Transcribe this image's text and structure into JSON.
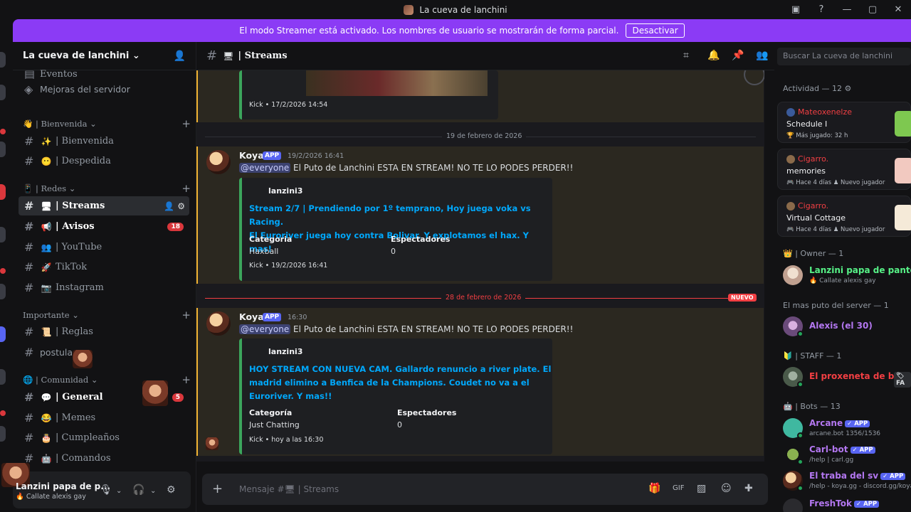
{
  "window": {
    "title": "La cueva de lanchini"
  },
  "banner": {
    "text": "El modo Streamer está activado. Los nombres de usuario se mostrarán de forma parcial.",
    "button": "Desactivar"
  },
  "server": {
    "name": "La cueva de lanchini ⌄"
  },
  "sidebar": {
    "top_items": [
      {
        "label": "Eventos"
      },
      {
        "label": "Mejoras del servidor"
      }
    ],
    "categories": {
      "bienvenida": "| Bienvenida ⌄",
      "redes": "| Redes ⌄",
      "importante": "Importante ⌄",
      "comunidad": "| Comunidad ⌄"
    },
    "channels": [
      {
        "emoji": "✨",
        "label": "| Bienvenida"
      },
      {
        "emoji": "😶",
        "label": "| Despedida"
      },
      {
        "emoji": "🖥",
        "label": "| Streams"
      },
      {
        "emoji": "📢",
        "label": "| Avisos",
        "badge": "18"
      },
      {
        "emoji": "👥",
        "label": "| YouTube"
      },
      {
        "emoji": "🚀",
        "label": "TikTok"
      },
      {
        "emoji": "📷",
        "label": "Instagram"
      },
      {
        "emoji": "📜",
        "label": "| Reglas"
      },
      {
        "emoji": "",
        "label": "postula"
      },
      {
        "emoji": "💬",
        "label": "| General",
        "badge": "5"
      },
      {
        "emoji": "😂",
        "label": "| Memes"
      },
      {
        "emoji": "🎂",
        "label": "| Cumpleaños"
      },
      {
        "emoji": "🤖",
        "label": "| Comandos"
      }
    ]
  },
  "user_panel": {
    "name": "Lanzini papa de p...",
    "status": "🔥 Callate alexis gay"
  },
  "channel_header": {
    "name": "| Streams",
    "search_placeholder": "Buscar La cueva de lanchini"
  },
  "messages": {
    "prev_footer": "Kick • 17/2/2026 14:54",
    "date_divider_1": "19 de febrero de 2026",
    "date_divider_2": "28 de febrero de 2026",
    "new_label": "NUEVO",
    "items": [
      {
        "author": "Koya",
        "app": "APP",
        "time": "19/2/2026 16:41",
        "mention": "@everyone",
        "text": " El Puto de Lanchini ESTA EN STREAM! NO TE LO PODES PERDER!!",
        "embed": {
          "author": "lanzini3",
          "title_lines": [
            "Stream 2/7 | Prendiendo por 1º temprano, Hoy juega voka vs Racing.",
            "El Euroriver juega hoy contra Bolivar. Y explotamos el hax. Y mas!"
          ],
          "field1_name": "Categoria",
          "field1_value": "Haxball",
          "field2_name": "Espectadores",
          "field2_value": "0",
          "footer": "Kick • 19/2/2026 16:41"
        }
      },
      {
        "author": "Koya",
        "app": "APP",
        "time": "16:30",
        "mention": "@everyone",
        "text": " El Puto de Lanchini ESTA EN STREAM! NO TE LO PODES PERDER!!",
        "embed": {
          "author": "lanzini3",
          "title_lines": [
            "HOY STREAM CON NUEVA CAM. Gallardo renuncio a river plate. El",
            "madrid elimino a Benfica de la Champions. Coudet no va a el",
            "Euroriver. Y mas!!"
          ],
          "field1_name": "Categoría",
          "field1_value": "Just Chatting",
          "field2_name": "Espectadores",
          "field2_value": "0",
          "footer": "Kick • hoy a las 16:30"
        }
      }
    ]
  },
  "composer": {
    "placeholder": "Mensaje #🖥 | Streams"
  },
  "members": {
    "activity_header": "Actividad — 12 ⚙",
    "activities": [
      {
        "name": "Mateoxenelze",
        "game": "Schedule I",
        "sub": "🏆 Más jugado: 32 h",
        "thumb": "#7ec850"
      },
      {
        "name": "Cigarro.",
        "game": "memories",
        "sub": "🎮 Hace 4 días   ♟ Nuevo jugador",
        "thumb": "#f2c9c0"
      },
      {
        "name": "Cigarro.",
        "game": "Virtual Cottage",
        "sub": "🎮 Hace 4 días   ♟ Nuevo jugador",
        "thumb": "#f5ead8"
      }
    ],
    "groups": [
      {
        "header": "👑 | Owner — 1",
        "members": [
          {
            "name": "Lanzini papa de pantox",
            "status": "🔥 Callate alexis gay",
            "color": "#57f287"
          }
        ]
      },
      {
        "header": "El mas puto del server — 1",
        "members": [
          {
            "name": "Alexis (el 30)",
            "status": "",
            "color": "#b377f0"
          }
        ]
      },
      {
        "header": "🔰 | STAFF — 1",
        "members": [
          {
            "name": "El proxeneta de b...",
            "status": "",
            "color": "#f23f43"
          }
        ]
      },
      {
        "header": "🤖 | Bots — 13",
        "members": [
          {
            "name": "Arcane",
            "status": "arcane.bot 1356/1536",
            "color": "#b377f0"
          },
          {
            "name": "Carl-bot",
            "status": "/help | carl.gg",
            "color": "#b377f0"
          },
          {
            "name": "El traba del sv",
            "status": "/help - koya.gg - discord.gg/koya",
            "color": "#b377f0"
          },
          {
            "name": "FreshTok",
            "status": "",
            "color": "#b377f0"
          }
        ]
      }
    ],
    "bot_app_label": "✓ APP",
    "staff_tag": "🏷 FA"
  }
}
